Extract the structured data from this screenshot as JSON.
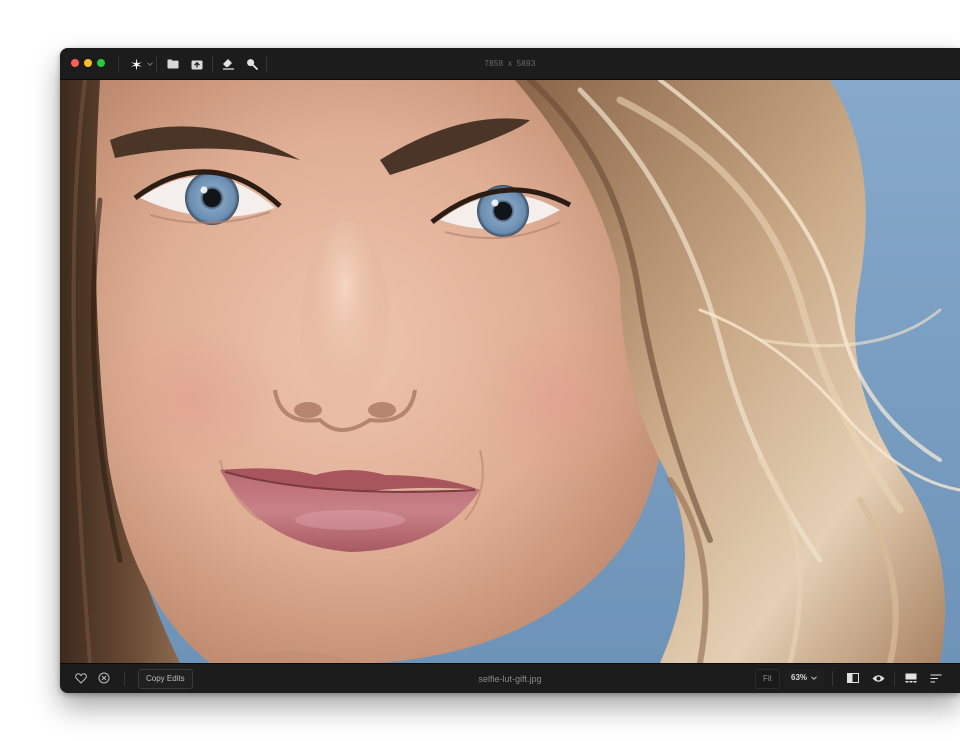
{
  "toolbar": {
    "traffic_lights": [
      "close",
      "minimize",
      "maximize"
    ],
    "tools": [
      {
        "name": "auto-enhance",
        "icon": "sparkle-icon",
        "has_dropdown": true
      },
      {
        "name": "browse-folder",
        "icon": "folder-icon"
      },
      {
        "name": "import-photo",
        "icon": "photo-import-icon"
      },
      {
        "name": "eraser",
        "icon": "eraser-icon"
      },
      {
        "name": "zoom",
        "icon": "magnifier-icon"
      }
    ],
    "image_dimensions": "7858  x  5893"
  },
  "canvas": {
    "description_icon": "photo-canvas"
  },
  "footer": {
    "favorite_icon": "heart-icon",
    "reject_icon": "reject-circle-x-icon",
    "copy_edits_label": "Copy Edits",
    "file_name": "selfie-lut-gift.jpg",
    "fit_label": "Fit",
    "zoom_value": "63%",
    "right_icons": [
      "compare-split-icon",
      "eye-icon",
      "filmstrip-icon",
      "sort-lines-icon"
    ]
  },
  "colors": {
    "window_bg": "#121212",
    "toolbar_bg": "#1c1c1d",
    "close": "#ff5f57",
    "minimize": "#febc2e",
    "maximize": "#28c840",
    "sky": "#7fa3c5"
  }
}
